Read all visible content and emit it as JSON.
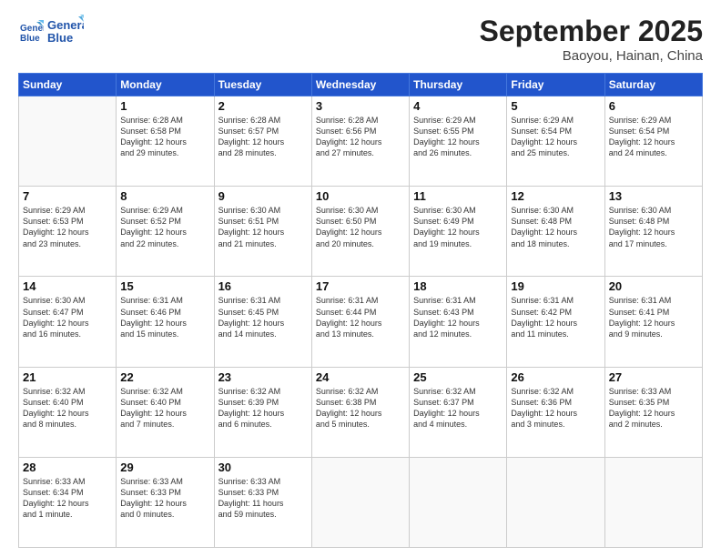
{
  "header": {
    "logo_line1": "General",
    "logo_line2": "Blue",
    "month": "September 2025",
    "location": "Baoyou, Hainan, China"
  },
  "weekdays": [
    "Sunday",
    "Monday",
    "Tuesday",
    "Wednesday",
    "Thursday",
    "Friday",
    "Saturday"
  ],
  "weeks": [
    [
      {
        "day": "",
        "info": ""
      },
      {
        "day": "1",
        "info": "Sunrise: 6:28 AM\nSunset: 6:58 PM\nDaylight: 12 hours\nand 29 minutes."
      },
      {
        "day": "2",
        "info": "Sunrise: 6:28 AM\nSunset: 6:57 PM\nDaylight: 12 hours\nand 28 minutes."
      },
      {
        "day": "3",
        "info": "Sunrise: 6:28 AM\nSunset: 6:56 PM\nDaylight: 12 hours\nand 27 minutes."
      },
      {
        "day": "4",
        "info": "Sunrise: 6:29 AM\nSunset: 6:55 PM\nDaylight: 12 hours\nand 26 minutes."
      },
      {
        "day": "5",
        "info": "Sunrise: 6:29 AM\nSunset: 6:54 PM\nDaylight: 12 hours\nand 25 minutes."
      },
      {
        "day": "6",
        "info": "Sunrise: 6:29 AM\nSunset: 6:54 PM\nDaylight: 12 hours\nand 24 minutes."
      }
    ],
    [
      {
        "day": "7",
        "info": "Sunrise: 6:29 AM\nSunset: 6:53 PM\nDaylight: 12 hours\nand 23 minutes."
      },
      {
        "day": "8",
        "info": "Sunrise: 6:29 AM\nSunset: 6:52 PM\nDaylight: 12 hours\nand 22 minutes."
      },
      {
        "day": "9",
        "info": "Sunrise: 6:30 AM\nSunset: 6:51 PM\nDaylight: 12 hours\nand 21 minutes."
      },
      {
        "day": "10",
        "info": "Sunrise: 6:30 AM\nSunset: 6:50 PM\nDaylight: 12 hours\nand 20 minutes."
      },
      {
        "day": "11",
        "info": "Sunrise: 6:30 AM\nSunset: 6:49 PM\nDaylight: 12 hours\nand 19 minutes."
      },
      {
        "day": "12",
        "info": "Sunrise: 6:30 AM\nSunset: 6:48 PM\nDaylight: 12 hours\nand 18 minutes."
      },
      {
        "day": "13",
        "info": "Sunrise: 6:30 AM\nSunset: 6:48 PM\nDaylight: 12 hours\nand 17 minutes."
      }
    ],
    [
      {
        "day": "14",
        "info": "Sunrise: 6:30 AM\nSunset: 6:47 PM\nDaylight: 12 hours\nand 16 minutes."
      },
      {
        "day": "15",
        "info": "Sunrise: 6:31 AM\nSunset: 6:46 PM\nDaylight: 12 hours\nand 15 minutes."
      },
      {
        "day": "16",
        "info": "Sunrise: 6:31 AM\nSunset: 6:45 PM\nDaylight: 12 hours\nand 14 minutes."
      },
      {
        "day": "17",
        "info": "Sunrise: 6:31 AM\nSunset: 6:44 PM\nDaylight: 12 hours\nand 13 minutes."
      },
      {
        "day": "18",
        "info": "Sunrise: 6:31 AM\nSunset: 6:43 PM\nDaylight: 12 hours\nand 12 minutes."
      },
      {
        "day": "19",
        "info": "Sunrise: 6:31 AM\nSunset: 6:42 PM\nDaylight: 12 hours\nand 11 minutes."
      },
      {
        "day": "20",
        "info": "Sunrise: 6:31 AM\nSunset: 6:41 PM\nDaylight: 12 hours\nand 9 minutes."
      }
    ],
    [
      {
        "day": "21",
        "info": "Sunrise: 6:32 AM\nSunset: 6:40 PM\nDaylight: 12 hours\nand 8 minutes."
      },
      {
        "day": "22",
        "info": "Sunrise: 6:32 AM\nSunset: 6:40 PM\nDaylight: 12 hours\nand 7 minutes."
      },
      {
        "day": "23",
        "info": "Sunrise: 6:32 AM\nSunset: 6:39 PM\nDaylight: 12 hours\nand 6 minutes."
      },
      {
        "day": "24",
        "info": "Sunrise: 6:32 AM\nSunset: 6:38 PM\nDaylight: 12 hours\nand 5 minutes."
      },
      {
        "day": "25",
        "info": "Sunrise: 6:32 AM\nSunset: 6:37 PM\nDaylight: 12 hours\nand 4 minutes."
      },
      {
        "day": "26",
        "info": "Sunrise: 6:32 AM\nSunset: 6:36 PM\nDaylight: 12 hours\nand 3 minutes."
      },
      {
        "day": "27",
        "info": "Sunrise: 6:33 AM\nSunset: 6:35 PM\nDaylight: 12 hours\nand 2 minutes."
      }
    ],
    [
      {
        "day": "28",
        "info": "Sunrise: 6:33 AM\nSunset: 6:34 PM\nDaylight: 12 hours\nand 1 minute."
      },
      {
        "day": "29",
        "info": "Sunrise: 6:33 AM\nSunset: 6:33 PM\nDaylight: 12 hours\nand 0 minutes."
      },
      {
        "day": "30",
        "info": "Sunrise: 6:33 AM\nSunset: 6:33 PM\nDaylight: 11 hours\nand 59 minutes."
      },
      {
        "day": "",
        "info": ""
      },
      {
        "day": "",
        "info": ""
      },
      {
        "day": "",
        "info": ""
      },
      {
        "day": "",
        "info": ""
      }
    ]
  ]
}
